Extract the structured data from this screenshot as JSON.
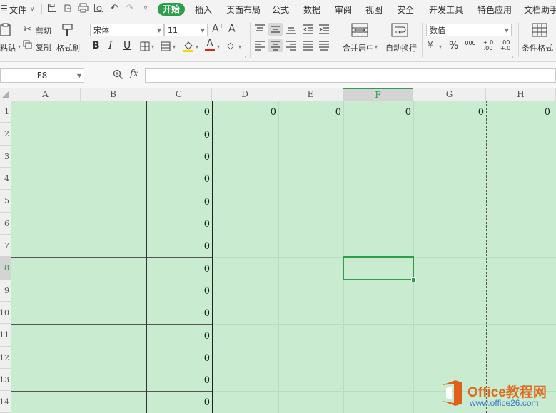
{
  "menu": {
    "file_label": "文件",
    "tabs": [
      "开始",
      "插入",
      "页面布局",
      "公式",
      "数据",
      "审阅",
      "视图",
      "安全",
      "开发工具",
      "特色应用",
      "文档助手"
    ],
    "active_tab": "开始"
  },
  "ribbon": {
    "paste": "粘贴",
    "cut": "剪切",
    "copy": "复制",
    "format_painter": "格式刷",
    "font_name": "宋体",
    "font_size": "11",
    "bold": "B",
    "italic": "I",
    "underline": "U",
    "merge_center": "合并居中",
    "wrap_text": "自动换行",
    "number_format": "数值",
    "percent": "%",
    "thousands": "000",
    "inc_decimal": "+.0 .00",
    "dec_decimal": ".00 +.0",
    "conditional_format": "条件格式"
  },
  "formula_bar": {
    "name_box": "F8",
    "fx_label": "fx",
    "formula_value": ""
  },
  "sheet": {
    "columns": [
      "A",
      "B",
      "C",
      "D",
      "E",
      "F",
      "G",
      "H"
    ],
    "row_labels": [
      "1",
      "2",
      "3",
      "4",
      "5",
      "6",
      "7",
      "8",
      "9",
      "10",
      "11",
      "12",
      "13",
      "14"
    ],
    "active_cell": "F8",
    "row1_values": {
      "C": "0",
      "D": "0",
      "E": "0",
      "F": "0",
      "G": "0",
      "H": "0"
    },
    "colC_values": [
      "0",
      "0",
      "0",
      "0",
      "0",
      "0",
      "0",
      "0",
      "0",
      "0",
      "0",
      "0",
      "0",
      "0"
    ]
  },
  "colors": {
    "accent": "#2e9e4b",
    "cell_fill": "#c9ebcf"
  },
  "watermark": {
    "line1": "Office教程网",
    "line2": "www.office26.com"
  }
}
